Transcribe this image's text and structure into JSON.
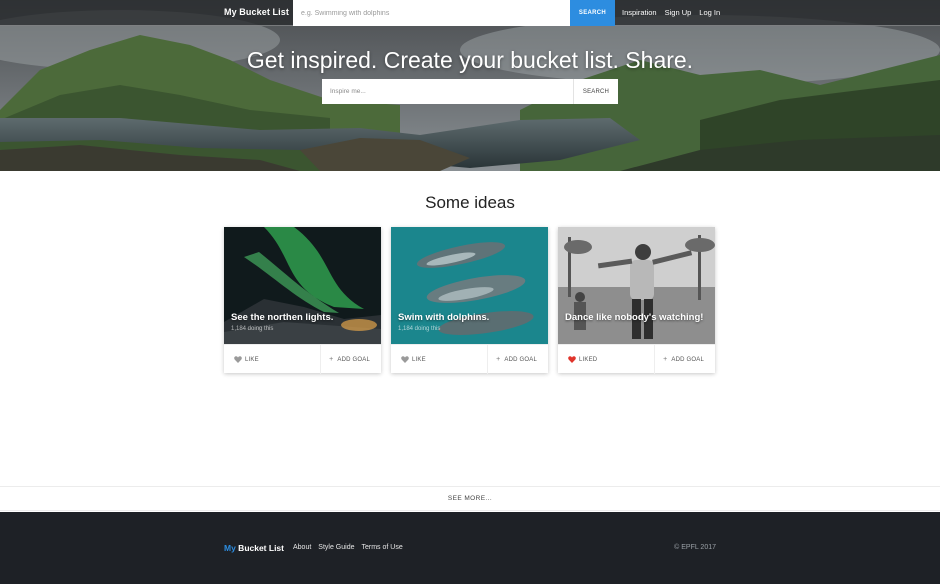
{
  "nav": {
    "brand": "My Bucket List",
    "search_placeholder": "e.g. Swimming with dolphins",
    "search_button": "SEARCH",
    "links": [
      "Inspiration",
      "Sign Up",
      "Log In"
    ]
  },
  "hero": {
    "title": "Get inspired. Create your bucket list. Share.",
    "search_placeholder": "Inspire me...",
    "search_button": "SEARCH"
  },
  "ideas": {
    "title": "Some ideas",
    "cards": [
      {
        "title": "See the northen lights.",
        "count": "1,184 doing this",
        "like_label": "LIKE",
        "liked": false,
        "add_label": "ADD GOAL",
        "image": "northern-lights"
      },
      {
        "title": "Swim with dolphins.",
        "count": "1,184 doing this",
        "like_label": "LIKE",
        "liked": false,
        "add_label": "ADD GOAL",
        "image": "dolphins"
      },
      {
        "title": "Dance like nobody's watching!",
        "count": "",
        "like_label": "LIKED",
        "liked": true,
        "add_label": "ADD GOAL",
        "image": "dancing-man"
      }
    ]
  },
  "see_more": "SEE MORE...",
  "footer": {
    "brand_part1": "My",
    "brand_part2": " Bucket List",
    "links": [
      "About",
      "Style Guide",
      "Terms of Use"
    ],
    "copyright": "© EPFL 2017"
  },
  "colors": {
    "accent": "#2d8de0",
    "footer_bg": "#1e2126",
    "liked_heart": "#e0342b",
    "heart_gray": "#9a9a9a"
  }
}
